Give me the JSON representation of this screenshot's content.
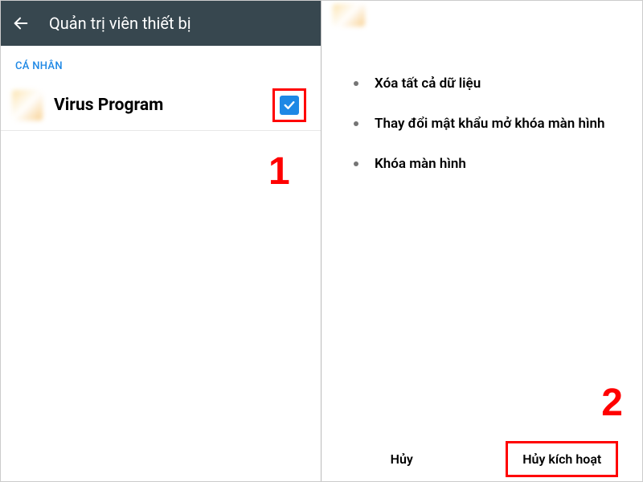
{
  "header": {
    "title": "Quản trị viên thiết bị"
  },
  "section": {
    "label": "CÁ NHÂN"
  },
  "app": {
    "name": "Virus Program"
  },
  "steps": {
    "one": "1",
    "two": "2"
  },
  "permissions": {
    "items": [
      "Xóa tất cả dữ liệu",
      "Thay đổi mật khẩu mở khóa màn hình",
      "Khóa màn hình"
    ]
  },
  "buttons": {
    "cancel": "Hủy",
    "deactivate": "Hủy kích hoạt"
  },
  "colors": {
    "accent": "#1e88e5",
    "highlight": "#ff0000",
    "topbar": "#37474f"
  }
}
